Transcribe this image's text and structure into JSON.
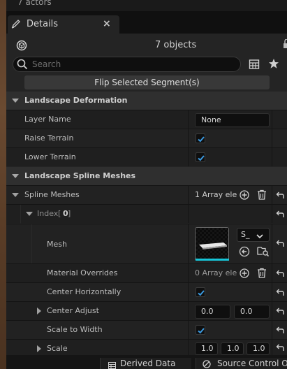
{
  "top_strip": {
    "text": "7 actors"
  },
  "tab": {
    "label": "Details",
    "close": "×"
  },
  "header": {
    "object_count": "7 objects"
  },
  "search": {
    "placeholder": "Search"
  },
  "flip_button": {
    "label": "Flip Selected Segment(s)"
  },
  "sections": {
    "landscape_deformation": "Landscape Deformation",
    "landscape_spline_meshes": "Landscape Spline Meshes"
  },
  "rows": {
    "layer_name": {
      "label": "Layer Name",
      "value": "None"
    },
    "raise_terrain": {
      "label": "Raise Terrain",
      "checked": true
    },
    "lower_terrain": {
      "label": "Lower Terrain",
      "checked": true
    },
    "spline_meshes": {
      "label": "Spline Meshes",
      "value": "1 Array ele"
    },
    "index": {
      "label": "Index",
      "bracket_open": "[",
      "index_value": "0",
      "bracket_close": "]"
    },
    "mesh": {
      "label": "Mesh",
      "combo": "S_"
    },
    "material_overrides": {
      "label": "Material Overrides",
      "value": "0 Array ele"
    },
    "center_horizontally": {
      "label": "Center Horizontally",
      "checked": true
    },
    "center_adjust": {
      "label": "Center Adjust",
      "x": "0.0",
      "y": "0.0"
    },
    "scale_to_width": {
      "label": "Scale to Width",
      "checked": true
    },
    "scale": {
      "label": "Scale",
      "x": "1.0",
      "y": "1.0",
      "z": "1.0"
    }
  },
  "bottom_bar": {
    "derived_data": "Derived Data",
    "source_control": "Source Control O"
  },
  "colors": {
    "accent_cyan": "#16c6d8",
    "checkbox_blue": "#3b9ae0"
  }
}
